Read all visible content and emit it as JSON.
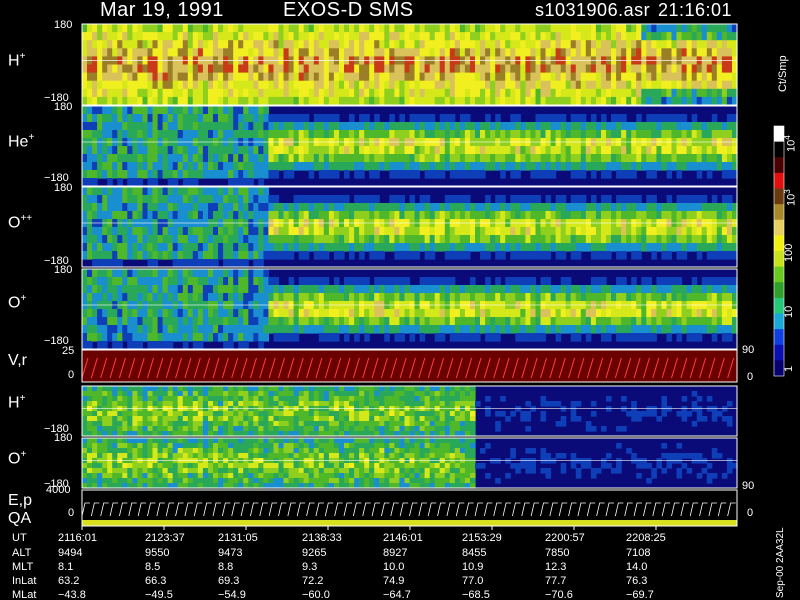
{
  "header": {
    "date": "Mar 19, 1991",
    "instrument": "EXOS-D SMS",
    "file": "s1031906.asr",
    "time": "21:16:01"
  },
  "colorbar": {
    "unit": "Ct/Smp",
    "ticks": [
      "1",
      "10",
      "100",
      "10",
      "10"
    ],
    "tick_exponents": [
      "",
      "",
      "",
      "3",
      "4"
    ],
    "colors": [
      "#08006e",
      "#0b0fb0",
      "#1040e0",
      "#1aa8d8",
      "#27c77a",
      "#2f9e2a",
      "#6ac91f",
      "#c8e31c",
      "#f2f212",
      "#e8d060",
      "#a88a2a",
      "#6a3a10",
      "#e11010",
      "#4a0000",
      "#000000",
      "#ffffff"
    ]
  },
  "panels": [
    {
      "id": "h-plus",
      "species": "H",
      "charge": "+",
      "ymax": "180",
      "ymin": "−180"
    },
    {
      "id": "he-plus",
      "species": "He",
      "charge": "+",
      "ymax": "180",
      "ymin": "−180"
    },
    {
      "id": "o-plusplus",
      "species": "O",
      "charge": "++",
      "ymax": "180",
      "ymin": "−180"
    },
    {
      "id": "o-plus",
      "species": "O",
      "charge": "+",
      "ymax": "180",
      "ymin": "−180"
    }
  ],
  "vr_panel": {
    "label": "V,r",
    "ymax": "25",
    "ymin": "0",
    "right_top": "90",
    "right_bottom": "0"
  },
  "lower_panels": [
    {
      "id": "h-plus-low",
      "species": "H",
      "charge": "+",
      "ymin": "−180"
    },
    {
      "id": "o-plus-low",
      "species": "O",
      "charge": "+",
      "ymax": "180",
      "ymin": "−180"
    }
  ],
  "ep_panel": {
    "label1": "E,p",
    "label2": "QA",
    "ymax": "4000",
    "ymin": "0",
    "right_top": "90",
    "right_bottom": "0"
  },
  "footer_tag": "Sep-00  2AA32L",
  "table": {
    "row_labels": [
      "UT",
      "ALT",
      "MLT",
      "InLat",
      "MLat"
    ],
    "columns": [
      {
        "UT": "2116:01",
        "ALT": "9494",
        "MLT": "8.1",
        "InLat": "63.2",
        "MLat": "−43.8"
      },
      {
        "UT": "2123:37",
        "ALT": "9550",
        "MLT": "8.5",
        "InLat": "66.3",
        "MLat": "−49.5"
      },
      {
        "UT": "2131:05",
        "ALT": "9473",
        "MLT": "8.8",
        "InLat": "69.3",
        "MLat": "−54.9"
      },
      {
        "UT": "2138:33",
        "ALT": "9265",
        "MLT": "9.3",
        "InLat": "72.2",
        "MLat": "−60.0"
      },
      {
        "UT": "2146:01",
        "ALT": "8927",
        "MLT": "10.0",
        "InLat": "74.9",
        "MLat": "−64.7"
      },
      {
        "UT": "2153:29",
        "ALT": "8455",
        "MLT": "10.9",
        "InLat": "77.0",
        "MLat": "−68.5"
      },
      {
        "UT": "2200:57",
        "ALT": "7850",
        "MLT": "12.3",
        "InLat": "77.7",
        "MLat": "−70.6"
      },
      {
        "UT": "2208:25",
        "ALT": "7108",
        "MLT": "14.0",
        "InLat": "76.3",
        "MLat": "−69.7"
      }
    ]
  },
  "chart_data": {
    "type": "heatmap",
    "title": "Mar 19, 1991   EXOS-D SMS",
    "xlabel": "UT",
    "x": [
      "2116:01",
      "2123:37",
      "2131:05",
      "2138:33",
      "2146:01",
      "2153:29",
      "2200:57",
      "2208:25"
    ],
    "series": [
      {
        "name": "H+",
        "ylim": [
          -180,
          180
        ]
      },
      {
        "name": "He+",
        "ylim": [
          -180,
          180
        ]
      },
      {
        "name": "O++",
        "ylim": [
          -180,
          180
        ]
      },
      {
        "name": "O+",
        "ylim": [
          -180,
          180
        ]
      },
      {
        "name": "V,r",
        "ylim": [
          0,
          25
        ]
      },
      {
        "name": "H+",
        "ylim": [
          -180,
          180
        ]
      },
      {
        "name": "O+",
        "ylim": [
          -180,
          180
        ]
      },
      {
        "name": "E,p",
        "ylim": [
          0,
          4000
        ]
      }
    ],
    "colorbar_label": "Ct/Smp",
    "grid": false
  }
}
